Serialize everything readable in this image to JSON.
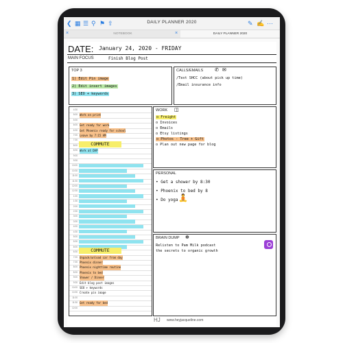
{
  "toolbar": {
    "title": "DAILY PLANNER 2020",
    "icons": [
      "back-icon",
      "grid-icon",
      "bookmark-list-icon",
      "search-icon",
      "bookmark-icon",
      "share-icon",
      "pencil-icon",
      "pen-edit-icon",
      "more-icon"
    ]
  },
  "tabs": {
    "notebook": "NOTEBOOK",
    "planner": "DAILY PLANNER 2020"
  },
  "planner": {
    "date_label": "DATE:",
    "date_value": "January 24, 2020 - FRIDAY",
    "main_focus_label": "MAIN FOCUS",
    "main_focus_value": "Finish Blog Post",
    "top3": {
      "title": "TOP 3",
      "items": [
        "1) Edit Pin image",
        "2) Edit insert images",
        "3) SEO + keywords"
      ]
    },
    "calls": {
      "title": "CALLS/EMAILS",
      "items": [
        "/Text SHCC (about pick up time)",
        "/Email insurance info"
      ]
    },
    "work": {
      "title": "WORK",
      "items": [
        "o Freight",
        "o Invoices",
        "o Emails",
        "o Etsy listings",
        "o Photos - Tree + Gift",
        "o Plan out new page for blog"
      ]
    },
    "personal": {
      "title": "PERSONAL",
      "items": [
        "• Get a shower by 8:30",
        "• Phoenix to bed by 8",
        "• Do yoga"
      ]
    },
    "brain_dump": {
      "title": "BRAIN DUMP",
      "lines": [
        "Relisten to Pam Milk podcast",
        "the secrets to organic growth"
      ]
    },
    "schedule": {
      "times": [
        "4:30",
        "5:00",
        "5:30",
        "6:00",
        "6:30",
        "7:00",
        "7:30",
        "8:00",
        "8:30",
        "9:00",
        "9:30",
        "10:00",
        "10:30",
        "11:00",
        "11:30",
        "12:00",
        "12:30",
        "1:00",
        "1:30",
        "2:00",
        "2:30",
        "3:00",
        "3:30",
        "4:00",
        "4:30",
        "5:00",
        "5:30",
        "6:00",
        "6:30",
        "7:00",
        "7:30",
        "8:00",
        "8:30",
        "9:00",
        "9:30",
        "10:00",
        "10:30",
        "11:00",
        "11:30",
        "12:00"
      ],
      "entries": {
        "work_on_print": "Work on print",
        "get_ready": "Get ready for work",
        "phoenix_ready": "Get Phoenix ready for school",
        "leave": "Leave by 7:15 AM",
        "commute_am": "COMMUTE",
        "work_at": "Work at DAP",
        "commute_pm": "COMMUTE",
        "unpack": "Unpack/unload car from day",
        "dinner": "Phoenix dinner",
        "nighttime": "Phoenix nighttime routine",
        "to_bed": "Phoenix to bed",
        "shower": "Shower / Dinner",
        "edit_blog": "Edit blog post images",
        "seo": "SEO + keywords",
        "create_pin": "Create pin image",
        "ready_bed": "Get ready for bed"
      }
    },
    "footer": {
      "logo": "HJ",
      "url": "www.heyjacqueline.com"
    },
    "colors": {
      "accent_blue": "#2a7de1",
      "highlight_yellow": "#f7ee6a",
      "highlight_cyan": "#8fe3ef",
      "highlight_orange": "#f7c08a",
      "highlight_green": "#b8e7a5"
    }
  }
}
